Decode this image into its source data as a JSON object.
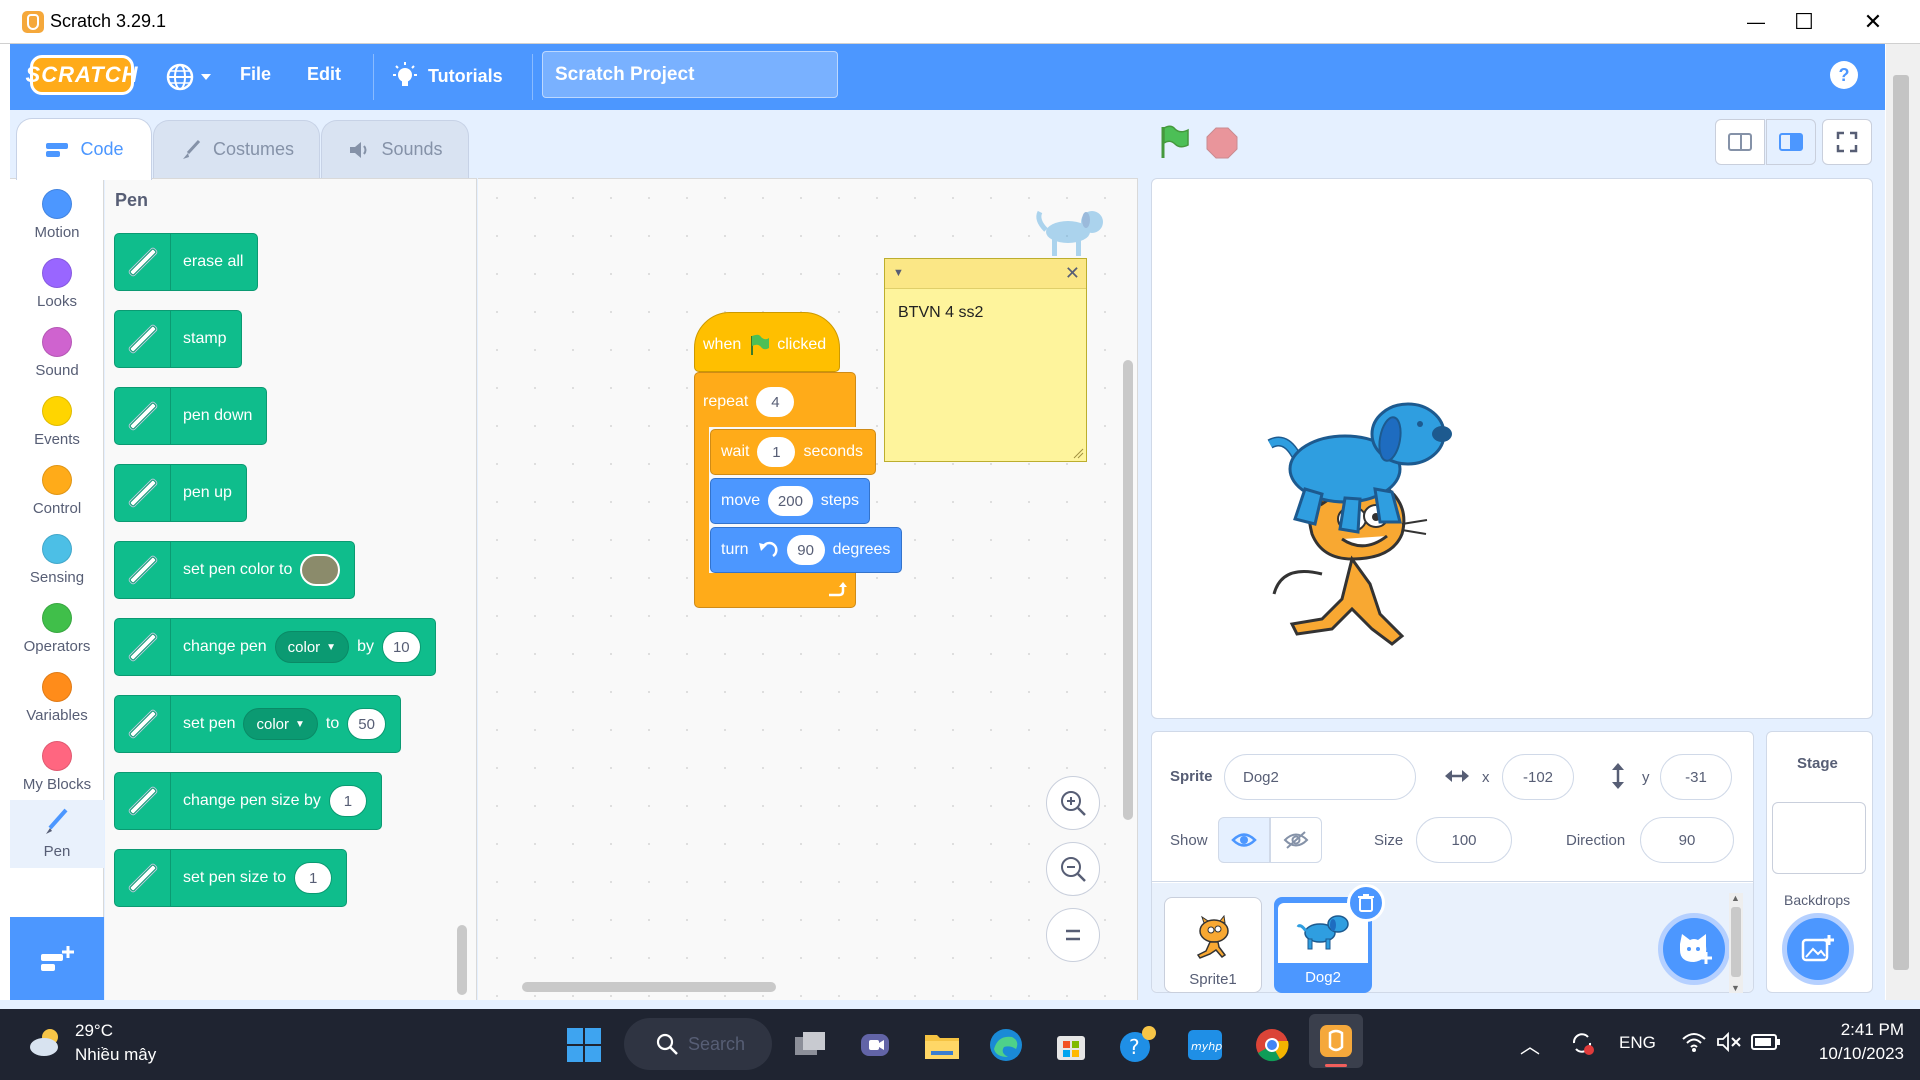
{
  "window": {
    "title": "Scratch 3.29.1",
    "minimize": "—",
    "maximize": "☐",
    "close": "✕"
  },
  "menubar": {
    "logo": "SCRATCH",
    "file": "File",
    "edit": "Edit",
    "tutorials": "Tutorials",
    "project_title": "Scratch Project",
    "help": "?"
  },
  "tabs": {
    "code": "Code",
    "costumes": "Costumes",
    "sounds": "Sounds"
  },
  "categories": [
    {
      "label": "Motion",
      "color": "#4c97ff"
    },
    {
      "label": "Looks",
      "color": "#9966ff"
    },
    {
      "label": "Sound",
      "color": "#cf63cf"
    },
    {
      "label": "Events",
      "color": "#ffd500"
    },
    {
      "label": "Control",
      "color": "#ffab19"
    },
    {
      "label": "Sensing",
      "color": "#4cbfe6"
    },
    {
      "label": "Operators",
      "color": "#40bf4a"
    },
    {
      "label": "Variables",
      "color": "#ff8c1a"
    },
    {
      "label": "My Blocks",
      "color": "#ff6680"
    },
    {
      "label": "Pen",
      "color": "#0fbd8c"
    }
  ],
  "palette": {
    "title": "Pen",
    "erase_all": "erase all",
    "stamp": "stamp",
    "pen_down": "pen down",
    "pen_up": "pen up",
    "set_color": "set pen color to",
    "pen_color_value": "#8b8b6b",
    "change_pen": "change pen",
    "color_option": "color",
    "by": "by",
    "change_value": "10",
    "set_pen": "set pen",
    "to": "to",
    "set_value": "50",
    "change_size": "change pen size by",
    "change_size_value": "1",
    "set_size": "set pen size to",
    "set_size_value": "1"
  },
  "script": {
    "when": "when",
    "clicked": "clicked",
    "repeat": "repeat",
    "repeat_value": "4",
    "wait": "wait",
    "wait_value": "1",
    "seconds": "seconds",
    "move": "move",
    "move_value": "200",
    "steps": "steps",
    "turn": "turn",
    "turn_value": "90",
    "degrees": "degrees",
    "comment": "BTVN 4 ss2"
  },
  "sprite_info": {
    "sprite_label": "Sprite",
    "sprite_name": "Dog2",
    "x_label": "x",
    "x_value": "-102",
    "y_label": "y",
    "y_value": "-31",
    "show_label": "Show",
    "size_label": "Size",
    "size_value": "100",
    "direction_label": "Direction",
    "direction_value": "90"
  },
  "sprites": [
    {
      "name": "Sprite1",
      "selected": false
    },
    {
      "name": "Dog2",
      "selected": true
    }
  ],
  "stage_pane": {
    "title": "Stage",
    "backdrops": "Backdrops"
  },
  "taskbar": {
    "weather_temp": "29°C",
    "weather_desc": "Nhiều mây",
    "search": "Search",
    "lang": "ENG",
    "time": "2:41 PM",
    "date": "10/10/2023"
  }
}
